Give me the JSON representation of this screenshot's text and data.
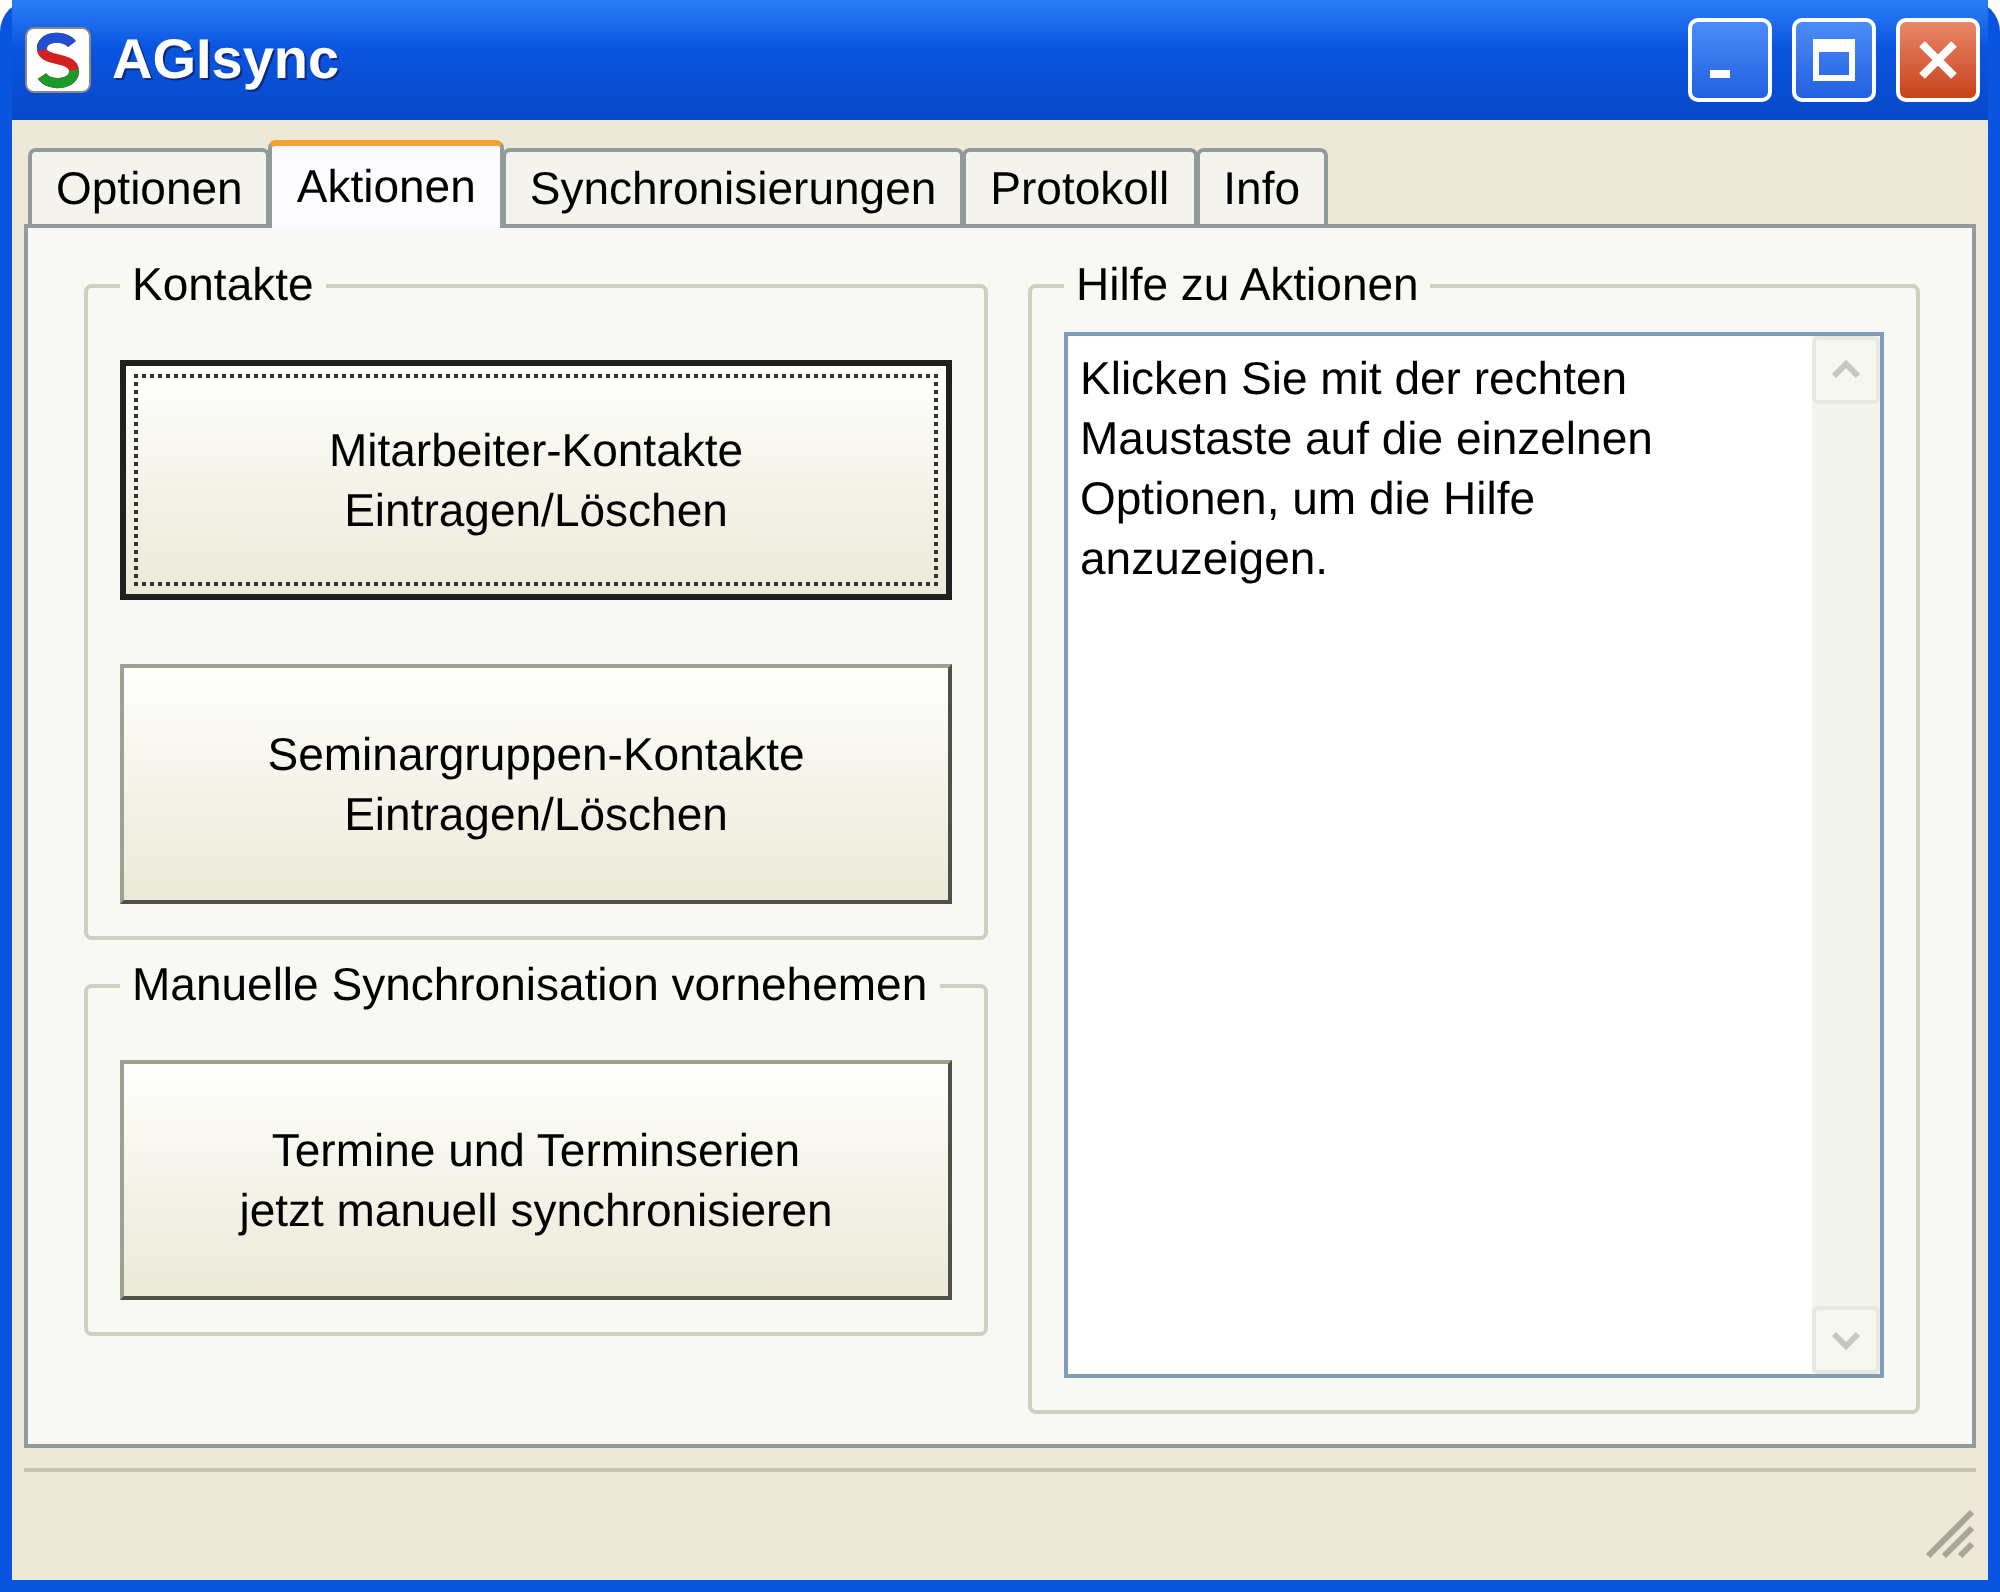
{
  "window": {
    "title": "AGIsync"
  },
  "tabs": [
    {
      "label": "Optionen",
      "selected": false
    },
    {
      "label": "Aktionen",
      "selected": true
    },
    {
      "label": "Synchronisierungen",
      "selected": false
    },
    {
      "label": "Protokoll",
      "selected": false
    },
    {
      "label": "Info",
      "selected": false
    }
  ],
  "groups": [
    {
      "title": "Kontakte",
      "buttons": [
        {
          "lines": [
            "Mitarbeiter-Kontakte",
            "Eintragen/Löschen"
          ],
          "focused": true
        },
        {
          "lines": [
            "Seminargruppen-Kontakte",
            "Eintragen/Löschen"
          ],
          "focused": false
        }
      ]
    },
    {
      "title": "Manuelle Synchronisation vornehemen",
      "buttons": [
        {
          "lines": [
            "Termine und Terminserien",
            "jetzt manuell synchronisieren"
          ],
          "focused": false
        }
      ]
    }
  ],
  "help": {
    "title": "Hilfe zu Aktionen",
    "text": "Klicken Sie mit der rechten Maustaste auf die einzelnen Optionen, um die Hilfe anzuzeigen."
  }
}
